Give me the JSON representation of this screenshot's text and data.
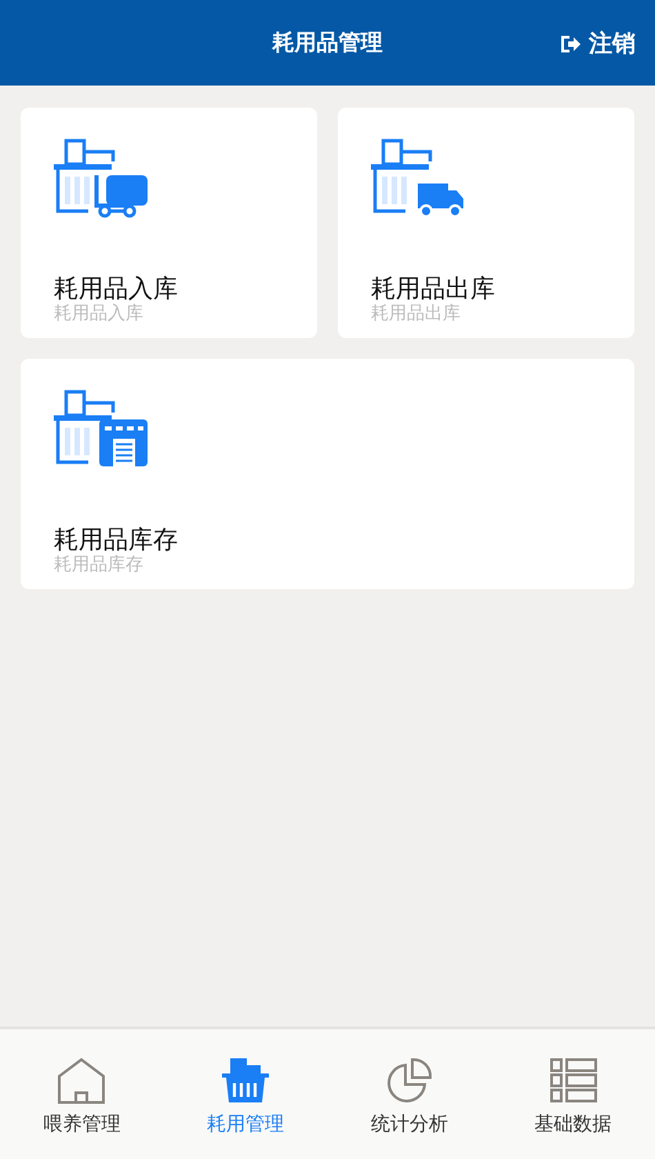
{
  "header": {
    "title": "耗用品管理",
    "logout": "注销"
  },
  "cards": [
    {
      "kind": "cart",
      "title": "耗用品入库",
      "subtitle": "耗用品入库"
    },
    {
      "kind": "truck",
      "title": "耗用品出库",
      "subtitle": "耗用品出库"
    },
    {
      "kind": "warehouse",
      "title": "耗用品库存",
      "subtitle": "耗用品库存"
    }
  ],
  "tabs": [
    {
      "kind": "home",
      "label": "喂养管理",
      "selected": false
    },
    {
      "kind": "basket",
      "label": "耗用管理",
      "selected": true
    },
    {
      "kind": "pie",
      "label": "统计分析",
      "selected": false
    },
    {
      "kind": "list",
      "label": "基础数据",
      "selected": false
    }
  ]
}
